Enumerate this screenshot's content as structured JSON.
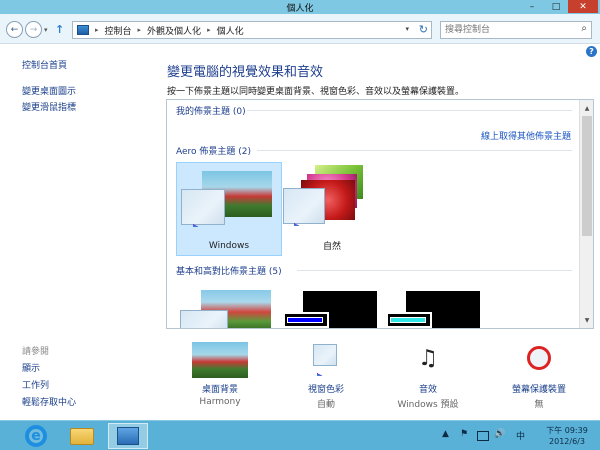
{
  "window": {
    "title": "個人化",
    "min_symbol": "–",
    "max_symbol": "□",
    "close_symbol": "✕"
  },
  "nav": {
    "back_symbol": "←",
    "forward_symbol": "→",
    "dropdown_symbol": "▾",
    "up_symbol": "↑",
    "breadcrumbs": [
      "控制台",
      "外觀及個人化",
      "個人化"
    ],
    "crumb_sep": "▸",
    "refresh_symbol": "↻",
    "search_placeholder": "搜尋控制台",
    "search_symbol": "⌕"
  },
  "sidebar": {
    "home": "控制台首頁",
    "links": [
      "變更桌面圖示",
      "變更滑鼠指標"
    ],
    "see_also_heading": "請參閱",
    "see_also": [
      "顯示",
      "工作列",
      "輕鬆存取中心"
    ]
  },
  "main": {
    "help_symbol": "?",
    "title": "變更電腦的視覺效果和音效",
    "description": "按一下佈景主題以同時變更桌面背景、視窗色彩、音效以及螢幕保護裝置。",
    "sections": {
      "my_themes": "我的佈景主題 (0)",
      "online_link": "線上取得其他佈景主題",
      "aero_themes": "Aero 佈景主題 (2)",
      "basic_themes": "基本和高對比佈景主題 (5)"
    },
    "aero_items": [
      {
        "name": "Windows",
        "selected": true
      },
      {
        "name": "自然",
        "selected": false
      }
    ],
    "scroll_up": "▲",
    "scroll_down": "▼"
  },
  "options": [
    {
      "label": "桌面背景",
      "sub": "Harmony"
    },
    {
      "label": "視窗色彩",
      "sub": "自動"
    },
    {
      "label": "音效",
      "sub": "Windows 預設"
    },
    {
      "label": "螢幕保護裝置",
      "sub": "無"
    }
  ],
  "taskbar": {
    "ie_glyph": "e",
    "tray_up": "▲",
    "flag": "⚑",
    "volume": "🔊",
    "ime": "中",
    "time": "下午 09:39",
    "date": "2012/6/3"
  }
}
